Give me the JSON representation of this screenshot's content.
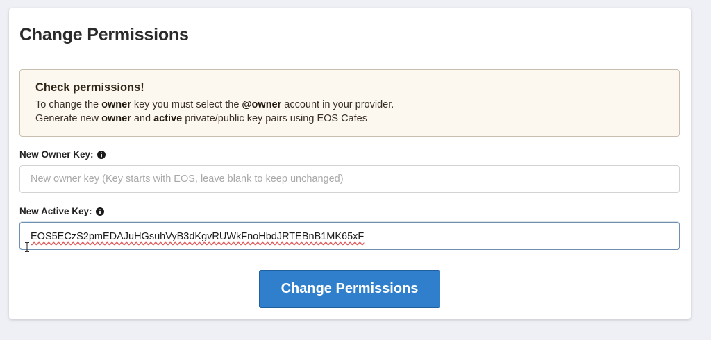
{
  "page": {
    "title": "Change Permissions"
  },
  "alert": {
    "heading": "Check permissions!",
    "line1": {
      "t1": "To change the ",
      "b1": "owner",
      "t2": " key you must select the ",
      "b2": "@owner",
      "t3": " account in your provider."
    },
    "line2": {
      "t1": "Generate new ",
      "b1": "owner",
      "t2": " and ",
      "b2": "active",
      "t3": " private/public key pairs using EOS Cafes"
    }
  },
  "owner_key": {
    "label": "New Owner Key:",
    "placeholder": "New owner key (Key starts with EOS, leave blank to keep unchanged)",
    "value": ""
  },
  "active_key": {
    "label": "New Active Key:",
    "value": "EOS5ECzS2pmEDAJuHGsuhVyB3dKgvRUWkFnoHbdJRTEBnB1MK65xF"
  },
  "submit": {
    "label": "Change Permissions"
  },
  "colors": {
    "button": "#2f7fcc",
    "alert_bg": "#fdf8ef",
    "page_bg": "#eef0f5"
  },
  "icons": {
    "info": "info-circle-icon",
    "cursor": "text-cursor-icon"
  }
}
